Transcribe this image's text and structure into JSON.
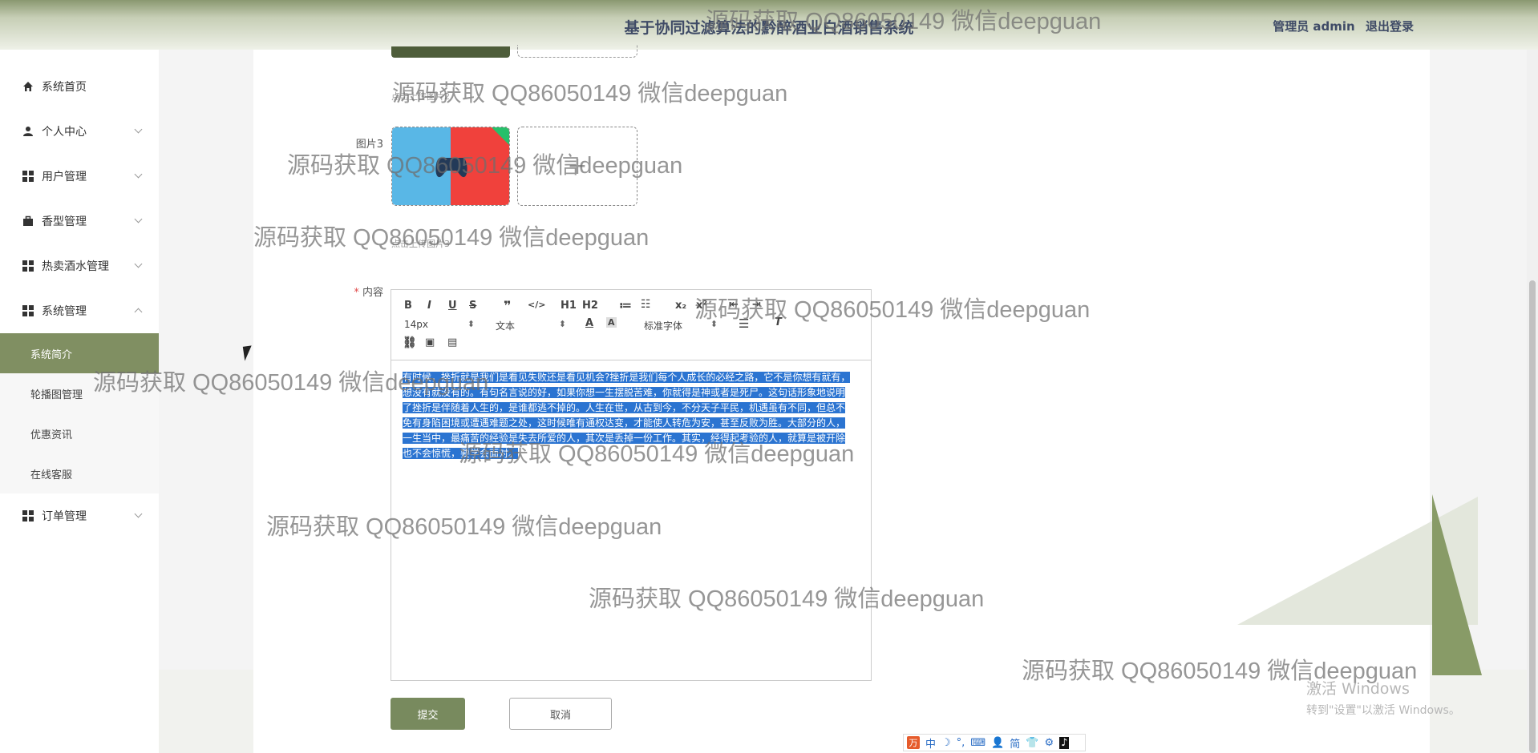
{
  "header": {
    "title": "基于协同过滤算法的黔醉酒业白酒销售系统",
    "user_label": "管理员 admin",
    "logout_label": "退出登录"
  },
  "sidebar": {
    "items": [
      {
        "label": "系统首页",
        "icon": "home-icon"
      },
      {
        "label": "个人中心",
        "icon": "user-icon"
      },
      {
        "label": "用户管理",
        "icon": "grid-icon"
      },
      {
        "label": "香型管理",
        "icon": "briefcase-icon"
      },
      {
        "label": "热卖酒水管理",
        "icon": "grid-icon"
      },
      {
        "label": "系统管理",
        "icon": "grid-icon"
      },
      {
        "label": "订单管理",
        "icon": "grid-icon"
      }
    ],
    "system_sub": [
      {
        "label": "系统简介",
        "active": true
      },
      {
        "label": "轮播图管理"
      },
      {
        "label": "优惠资讯"
      },
      {
        "label": "在线客服"
      }
    ]
  },
  "form": {
    "image2_hint": "点击上传图片2",
    "image3_label": "图片3",
    "image3_hint": "点击上传图片3",
    "upload_plus": "+",
    "content_required_mark": "*",
    "content_label": "内容"
  },
  "editor": {
    "toolbar_row1": [
      "B",
      "I",
      "U",
      "S",
      "❞",
      "</>",
      "H1",
      "H2",
      "≔",
      "☷",
      "x₂",
      "x²",
      "⇤",
      "⇥"
    ],
    "font_size": "14px",
    "text_style": "文本",
    "font_family": "标准字体",
    "content": "有时候，挫折就是我们是看见失败还是看见机会?挫折是我们每个人成长的必经之路，它不是你想有就有，想没有就没有的。有句名言说的好，如果你想一生摆脱苦难，你就得是神或者是死尸。这句话形象地说明了挫折是伴随着人生的，是谁都逃不掉的。人生在世，从古到今，不分天子平民，机遇虽有不同，但总不免有身陷困境或遭遇难题之处，这时候唯有通权达变，才能使人转危为安，甚至反败为胜。大部分的人，一生当中，最痛苦的经验是失去所爱的人，其次是丢掉一份工作。其实，经得起考验的人，就算是被开除也不会惊慌，要学会面对。"
  },
  "buttons": {
    "submit": "提交",
    "cancel": "取消"
  },
  "watermark_text": "源码获取 QQ86050149 微信deepguan",
  "os": {
    "activate_title": "激活 Windows",
    "activate_sub": "转到\"设置\"以激活 Windows。"
  },
  "ime": {
    "logo": "万",
    "items": [
      "中",
      "☽",
      "°,",
      "⌨",
      "👤",
      "简",
      "👕",
      "⚙",
      "♪"
    ]
  },
  "colors": {
    "accent": "#808f62",
    "submit": "#788a5e",
    "selection": "#2b74d1",
    "title": "#3f4b66"
  }
}
